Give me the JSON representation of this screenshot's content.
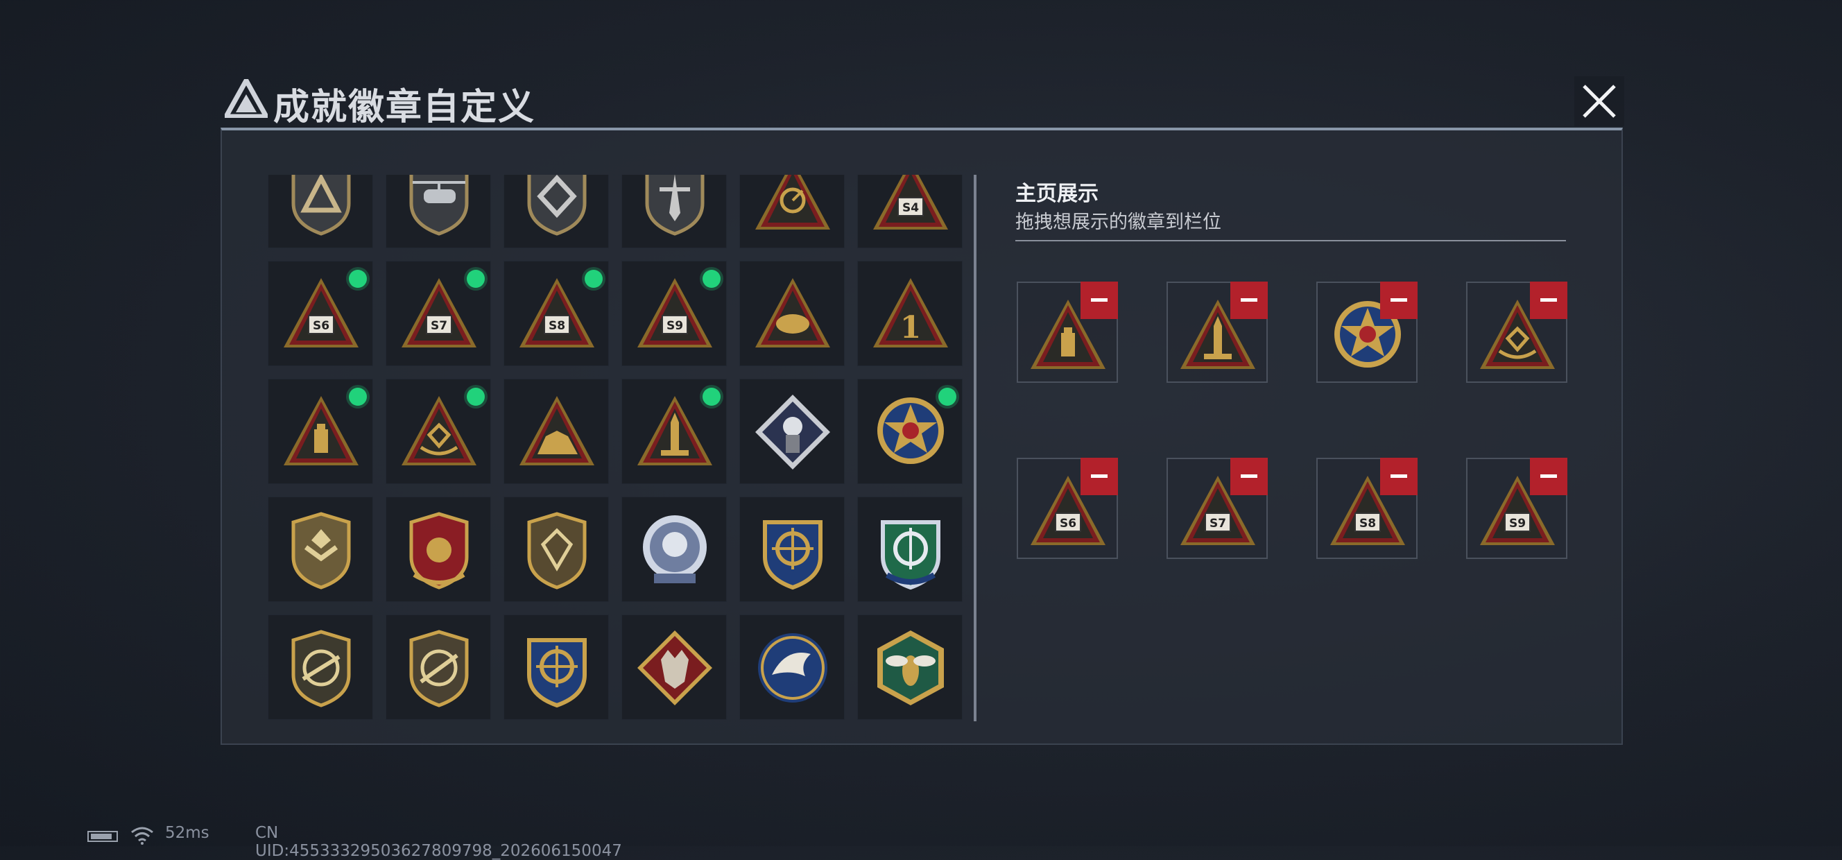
{
  "window": {
    "title": "成就徽章自定义",
    "close_label": "close"
  },
  "colors": {
    "accent_green": "#21d27b",
    "remove_red": "#b3212b",
    "gold": "#c9a24c",
    "maroon": "#7a1d1f"
  },
  "collection": {
    "badges": [
      {
        "name": "shield-triangle-badge",
        "icon": "shield-triangle",
        "new": false
      },
      {
        "name": "helicopter-badge",
        "icon": "helicopter",
        "new": false
      },
      {
        "name": "shield-diamond-badge",
        "icon": "shield-diamond",
        "new": false
      },
      {
        "name": "shield-dagger-badge",
        "icon": "shield-dagger",
        "new": false
      },
      {
        "name": "radar-triangle-badge",
        "icon": "radar",
        "new": false
      },
      {
        "name": "s4-triangle-badge",
        "icon": "s4",
        "label": "S4",
        "new": false
      },
      {
        "name": "s6-triangle-badge",
        "icon": "s6",
        "label": "S6",
        "new": true
      },
      {
        "name": "s7-triangle-badge",
        "icon": "s7",
        "label": "S7",
        "new": true
      },
      {
        "name": "s8-triangle-badge",
        "icon": "s8",
        "label": "S8",
        "new": true
      },
      {
        "name": "s9-triangle-badge",
        "icon": "s9",
        "label": "S9",
        "new": true
      },
      {
        "name": "hands-triangle-badge",
        "icon": "hands",
        "new": false
      },
      {
        "name": "one-triangle-badge",
        "icon": "one",
        "label": "1",
        "new": false
      },
      {
        "name": "usb-triangle-badge",
        "icon": "usb",
        "new": true
      },
      {
        "name": "hands-gem-triangle-badge",
        "icon": "hands-gem",
        "new": true
      },
      {
        "name": "dinosaur-triangle-badge",
        "icon": "dino",
        "new": false
      },
      {
        "name": "rocket-triangle-badge",
        "icon": "rocket",
        "new": true
      },
      {
        "name": "rose-diamond-badge",
        "icon": "rose",
        "new": false
      },
      {
        "name": "star-circle-badge",
        "icon": "star-circle",
        "new": true
      },
      {
        "name": "chevron-shield-badge",
        "icon": "chevron-shield",
        "new": false
      },
      {
        "name": "laurel-shield-badge",
        "icon": "laurel-shield",
        "new": false
      },
      {
        "name": "gem-shield-badge",
        "icon": "gem-shield",
        "new": false
      },
      {
        "name": "skull-silver-badge",
        "icon": "skull-silver",
        "new": false
      },
      {
        "name": "crosshair-gold-badge",
        "icon": "crosshair-gold",
        "new": false
      },
      {
        "name": "crosshair-green-badge",
        "icon": "crosshair-green",
        "new": false
      },
      {
        "name": "rifle-shield-badge",
        "icon": "rifle-shield",
        "new": false
      },
      {
        "name": "sniper-shield-badge",
        "icon": "sniper-shield",
        "new": false
      },
      {
        "name": "crosshair-gold-2-badge",
        "icon": "crosshair-gold",
        "new": false
      },
      {
        "name": "wolf-diamond-badge",
        "icon": "wolf",
        "new": false
      },
      {
        "name": "eagle-circle-badge",
        "icon": "eagle",
        "new": false
      },
      {
        "name": "wasp-hexagon-badge",
        "icon": "wasp",
        "new": false
      }
    ]
  },
  "showcase": {
    "title": "主页展示",
    "subtitle": "拖拽想展示的徽章到栏位",
    "slots": [
      {
        "name": "usb-triangle-badge",
        "icon": "usb"
      },
      {
        "name": "rocket-triangle-badge",
        "icon": "rocket"
      },
      {
        "name": "star-circle-badge",
        "icon": "star-circle"
      },
      {
        "name": "hands-gem-triangle-badge",
        "icon": "hands-gem"
      },
      {
        "name": "s6-triangle-badge",
        "icon": "s6",
        "label": "S6"
      },
      {
        "name": "s7-triangle-badge",
        "icon": "s7",
        "label": "S7"
      },
      {
        "name": "s8-triangle-badge",
        "icon": "s8",
        "label": "S8"
      },
      {
        "name": "s9-triangle-badge",
        "icon": "s9",
        "label": "S9"
      }
    ]
  },
  "status_bar": {
    "ping": "52ms",
    "uid": "CN UID:45533329503627809798_202606150047"
  }
}
